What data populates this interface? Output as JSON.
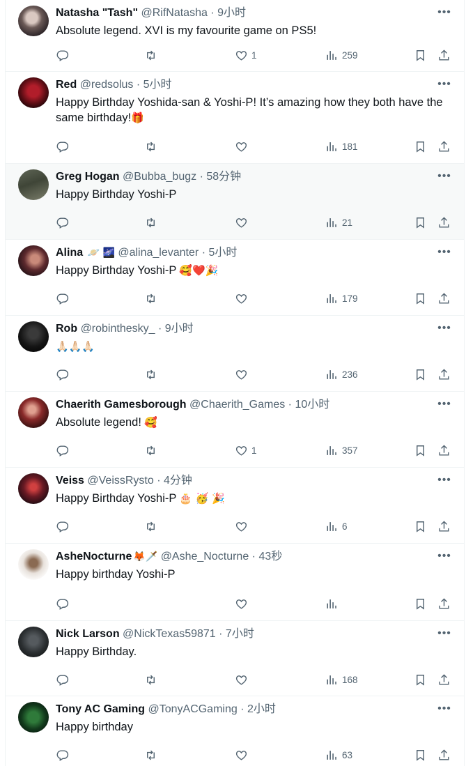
{
  "colors": {
    "text_primary": "#0f1419",
    "text_secondary": "#536471",
    "divider": "#eff3f4",
    "hover_bg": "#f7f9f9"
  },
  "icons": {
    "reply": "reply-icon",
    "retweet": "retweet-icon",
    "like": "heart-icon",
    "views": "views-icon",
    "bookmark": "bookmark-icon",
    "share": "share-icon",
    "more": "more-icon"
  },
  "replies": [
    {
      "name": "Natasha \"Tash\"",
      "handle": "@RifNatasha",
      "dot": "·",
      "time": "9小时",
      "text": "Absolute legend. XVI is my favourite game on PS5!",
      "likes": "1",
      "views": "259"
    },
    {
      "name": "Red",
      "handle": "@redsolus",
      "dot": "·",
      "time": "5小时",
      "text": "Happy Birthday Yoshida-san & Yoshi-P! It’s amazing how they both have the same birthday!",
      "emoji": "🎁",
      "likes": "",
      "views": "181"
    },
    {
      "name": "Greg Hogan",
      "handle": "@Bubba_bugz",
      "dot": "·",
      "time": "58分钟",
      "text": "Happy Birthday Yoshi-P",
      "likes": "",
      "views": "21"
    },
    {
      "name": "Alina",
      "name_emoji": "🪐 🌌",
      "handle": "@alina_levanter",
      "dot": "·",
      "time": "5小时",
      "text": "Happy Birthday Yoshi-P",
      "emoji": "🥰❤️🎉",
      "likes": "",
      "views": "179"
    },
    {
      "name": "Rob",
      "handle": "@robinthesky_",
      "dot": "·",
      "time": "9小时",
      "text": "",
      "emoji": "🙏🏻🙏🏻🙏🏻",
      "likes": "",
      "views": "236"
    },
    {
      "name": "Chaerith Gamesborough",
      "handle": "@Chaerith_Games",
      "dot": "·",
      "time": "10小时",
      "text": "Absolute legend!",
      "emoji": "🥰",
      "likes": "1",
      "views": "357"
    },
    {
      "name": "Veiss",
      "handle": "@VeissRysto",
      "dot": "·",
      "time": "4分钟",
      "text": "Happy Birthday Yoshi-P",
      "emoji": "🎂 🥳 🎉",
      "likes": "",
      "views": "6"
    },
    {
      "name": "AsheNocturne",
      "name_emoji": "🦊🗡️",
      "handle": "@Ashe_Nocturne",
      "dot": "·",
      "time": "43秒",
      "text": "Happy birthday Yoshi-P",
      "likes": "",
      "views": ""
    },
    {
      "name": "Nick Larson",
      "handle": "@NickTexas59871",
      "dot": "·",
      "time": "7小时",
      "text": "Happy Birthday.",
      "likes": "",
      "views": "168"
    },
    {
      "name": "Tony AC Gaming",
      "handle": "@TonyACGaming",
      "dot": "·",
      "time": "2小时",
      "text": "Happy birthday",
      "likes": "",
      "views": "63"
    }
  ]
}
